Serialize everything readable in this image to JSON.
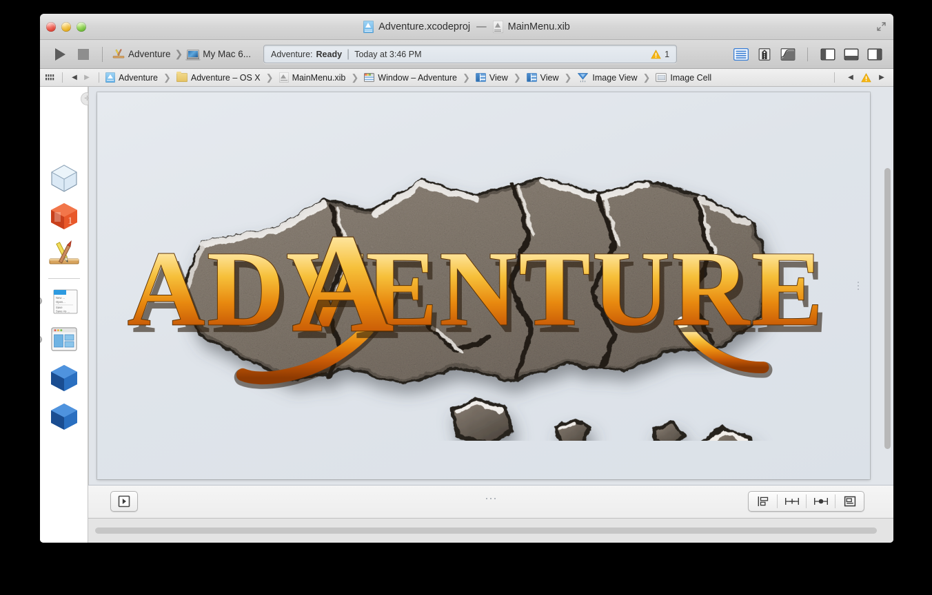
{
  "window": {
    "title_project": "Adventure.xcodeproj",
    "title_dash": "—",
    "title_file": "MainMenu.xib",
    "traffic_lights": [
      "close",
      "minimize",
      "zoom"
    ],
    "fullscreen_label": "Enter Full Screen"
  },
  "toolbar": {
    "run_label": "Run",
    "stop_label": "Stop",
    "scheme_project": "Adventure",
    "scheme_destination": "My Mac 6...",
    "status": {
      "prefix": "Adventure:",
      "state": "Ready",
      "separator": "|",
      "timestamp": "Today at 3:46 PM",
      "warning_count": "1"
    },
    "editor_buttons": [
      {
        "name": "standard-editor",
        "label": "Standard Editor",
        "active": true
      },
      {
        "name": "assistant-editor",
        "label": "Assistant Editor",
        "active": false
      },
      {
        "name": "version-editor",
        "label": "Version Editor",
        "active": false
      }
    ],
    "view_buttons": [
      {
        "name": "toggle-navigator",
        "label": "Hide or show the Navigator"
      },
      {
        "name": "toggle-debug-area",
        "label": "Hide or show the Debug area"
      },
      {
        "name": "toggle-utilities",
        "label": "Hide or show the Utilities"
      }
    ]
  },
  "jumpbar": {
    "related_items_label": "Related Items",
    "back_label": "Back",
    "forward_label": "Forward",
    "crumbs": [
      {
        "label": "Adventure",
        "icon": "project-icon"
      },
      {
        "label": "Adventure – OS X",
        "icon": "folder-icon"
      },
      {
        "label": "MainMenu.xib",
        "icon": "xib-icon"
      },
      {
        "label": "Window – Adventure",
        "icon": "window-icon"
      },
      {
        "label": "View",
        "icon": "view-icon"
      },
      {
        "label": "View",
        "icon": "view-icon"
      },
      {
        "label": "Image View",
        "icon": "image-view-icon"
      },
      {
        "label": "Image Cell",
        "icon": "image-cell-icon"
      }
    ],
    "crumb_separator": "❯",
    "issue_nav": {
      "previous_label": "Previous Issue",
      "next_label": "Next Issue",
      "badge": "warning-icon"
    }
  },
  "dock": {
    "zoom_badge": "✛",
    "objects": [
      {
        "name": "files-owner",
        "label": "File's Owner",
        "icon": "wireframe-cube-icon",
        "selected_dot": false
      },
      {
        "name": "first-responder",
        "label": "First Responder",
        "icon": "orange-cube-icon",
        "selected_dot": false
      },
      {
        "name": "application",
        "label": "Application",
        "icon": "xcode-tools-icon",
        "selected_dot": false
      },
      {
        "name": "main-menu",
        "label": "Main Menu",
        "icon": "menu-icon",
        "selected_dot": true
      },
      {
        "name": "window",
        "label": "Window – Adventure",
        "icon": "window-icon",
        "selected_dot": true
      },
      {
        "name": "object-1",
        "label": "Object",
        "icon": "blue-cube-icon",
        "selected_dot": false
      },
      {
        "name": "object-2",
        "label": "Object",
        "icon": "blue-cube-icon",
        "selected_dot": false
      }
    ]
  },
  "canvas": {
    "background_color": "#e1e5ea",
    "artwork": {
      "name": "adventure-logo",
      "title_text": "ADVENTURE",
      "style": "stone slab with gold beveled lettering",
      "stone_color": "#6b6158",
      "gold_color": "#f5a21a",
      "highlight_color": "#ffffff"
    }
  },
  "canvas_bottom": {
    "outline_toggle_label": "Show Document Outline",
    "autolayout_buttons": [
      {
        "name": "align",
        "label": "Align"
      },
      {
        "name": "pin",
        "label": "Pin"
      },
      {
        "name": "resolve",
        "label": "Resolve Auto Layout Issues"
      },
      {
        "name": "resize",
        "label": "Resizing Behavior"
      }
    ]
  },
  "colors": {
    "accent_blue": "#3b7fd4",
    "warning_yellow": "#f5b400",
    "toolbar_gray": "#d3d3d3",
    "canvas_gray": "#e1e5ea"
  }
}
